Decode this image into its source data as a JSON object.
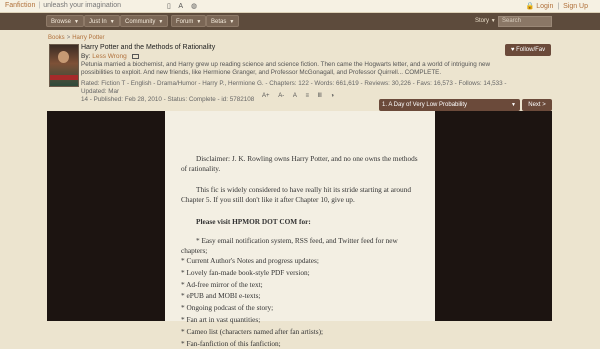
{
  "site": {
    "name": "Fanfiction",
    "separator": "|",
    "tagline": "unleash your imagination"
  },
  "toolbar_icons": [
    "phone-icon",
    "font-icon",
    "globe-icon"
  ],
  "account": {
    "login": "Login",
    "signup": "Sign Up",
    "sep": "|"
  },
  "nav": {
    "browse": "Browse",
    "justin": "Just In",
    "community": "Community",
    "forum": "Forum",
    "betas": "Betas",
    "story": "Story",
    "search_placeholder": "Search"
  },
  "breadcrumb": {
    "root": "Books",
    "gt": ">",
    "leaf": "Harry Potter"
  },
  "story": {
    "title": "Harry Potter and the Methods of Rationality",
    "by_label": "By:",
    "author": "Less Wrong",
    "summary": "Petunia married a biochemist, and Harry grew up reading science and science fiction. Then came the Hogwarts letter, and a world of intriguing new possibilities to exploit. And new friends, like Hermione Granger, and Professor McGonagall, and Professor Quirrell... COMPLETE.",
    "meta_line1": "Rated: Fiction T - English - Drama/Humor - Harry P., Hermione G. - Chapters: 122 - Words: 661,619 - Reviews: 30,226 - Favs: 16,573 - Follows: 14,533 - Updated: Mar",
    "meta_line2": "14 - Published: Feb 28, 2010 - Status: Complete - id: 5782108",
    "follow_label": "Follow/Fav"
  },
  "reader_tools": [
    "A+",
    "A-",
    "A",
    "≡",
    "Ⅲ",
    "◑"
  ],
  "chapter": {
    "selected": "1. A Day of Very Low Probability",
    "next_label": "Next >"
  },
  "content": {
    "p1": "Disclaimer: J. K. Rowling owns Harry Potter, and no one owns the methods of rationality.",
    "p2": "This fic is widely considered to have really hit its stride starting at around Chapter 5. If you still don't like it after Chapter 10, give up.",
    "p3": "Please visit HPMOR DOT COM for:",
    "items": [
      "* Easy email notification system, RSS feed, and Twitter feed for new chapters;",
      "* Current Author's Notes and progress updates;",
      "* Lovely fan-made book-style PDF version;",
      "* Ad-free mirror of the text;",
      "* ePUB and MOBI e-texts;",
      "* Ongoing podcast of the story;",
      "* Fan art in vast quantities;",
      "* Cameo list (characters named after fan artists);",
      "* Fan-fanfiction of this fanfiction;"
    ]
  }
}
